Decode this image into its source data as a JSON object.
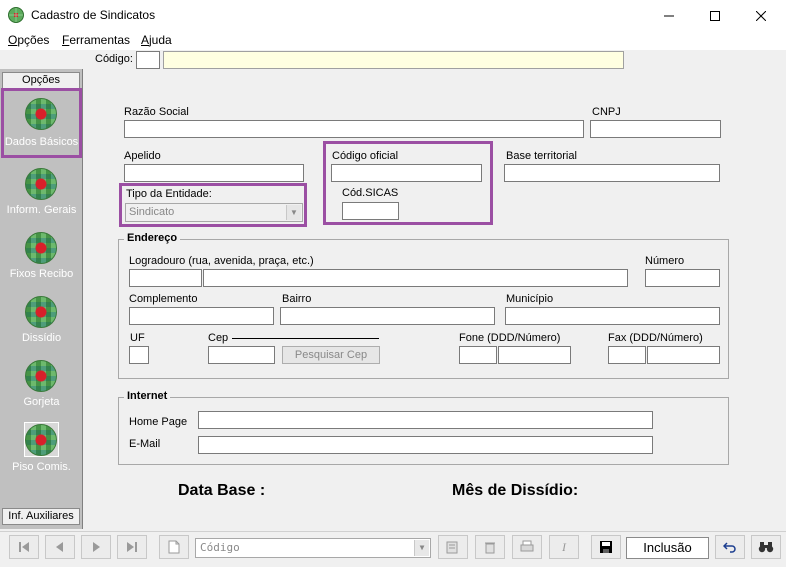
{
  "window": {
    "title": "Cadastro de Sindicatos",
    "minimize": "—",
    "maximize": "☐",
    "close": "✕"
  },
  "menu": {
    "items": [
      {
        "label": "Opções",
        "accel": "O",
        "rest": "pções"
      },
      {
        "label": "Ferramentas",
        "accel": "F",
        "rest": "erramentas"
      },
      {
        "label": "Ajuda",
        "accel": "A",
        "rest": "juda"
      }
    ]
  },
  "code_bar": {
    "label": "Código:",
    "value": ""
  },
  "sidebar": {
    "header": "Opções",
    "footer": "Inf. Auxiliares",
    "items": [
      {
        "label": "Dados Básicos",
        "icon": "globe-icon"
      },
      {
        "label": "Inform. Gerais",
        "icon": "globe-icon"
      },
      {
        "label": "Fixos Recibo",
        "icon": "globe-icon"
      },
      {
        "label": "Dissídio",
        "icon": "globe-icon"
      },
      {
        "label": "Gorjeta",
        "icon": "globe-icon"
      },
      {
        "label": "Piso Comis.",
        "icon": "globe-icon"
      }
    ],
    "selected": "Dados Básicos"
  },
  "form": {
    "razao_social_label": "Razão Social",
    "cnpj_label": "CNPJ",
    "apelido_label": "Apelido",
    "codigo_oficial_label": "Código oficial",
    "base_territorial_label": "Base territorial",
    "tipo_entidade_label": "Tipo da Entidade:",
    "tipo_entidade_value": "Sindicato",
    "cod_sicas_label": "Cód.SICAS",
    "endereco": {
      "title": "Endereço",
      "logradouro_label": "Logradouro (rua, avenida, praça, etc.)",
      "numero_label": "Número",
      "complemento_label": "Complemento",
      "bairro_label": "Bairro",
      "municipio_label": "Município",
      "uf_label": "UF",
      "cep_label": "Cep",
      "pesquisar_cep_label": "Pesquisar Cep",
      "fone_label": "Fone (DDD/Número)",
      "fax_label": "Fax (DDD/Número)"
    },
    "internet": {
      "title": "Internet",
      "home_page_label": "Home Page",
      "email_label": "E-Mail"
    },
    "data_base_label": "Data Base :",
    "mes_dissidio_label": "Mês de Dissídio:"
  },
  "toolbar": {
    "search_combo_value": "Código",
    "status": "Inclusão",
    "italic_label": "I"
  },
  "colors": {
    "highlight": "#9b4fa3",
    "sidebar_bg": "#c0c0c0",
    "code_field_bg": "#ffffe1"
  }
}
